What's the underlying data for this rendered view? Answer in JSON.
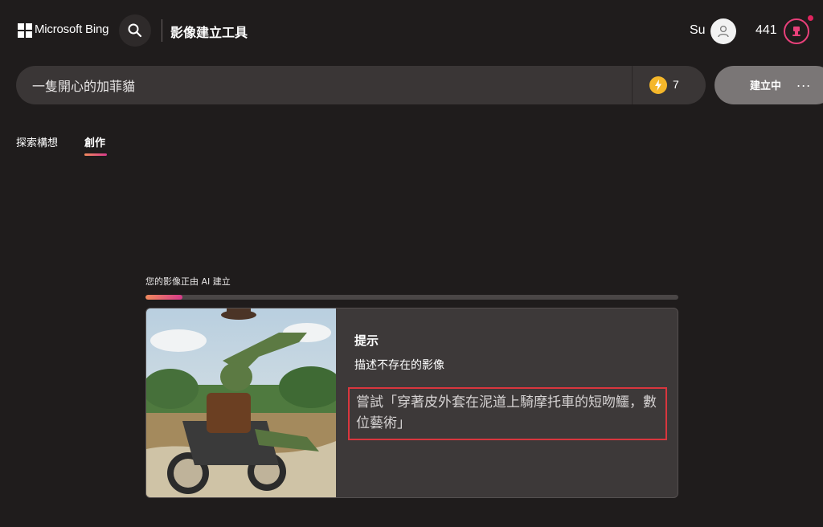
{
  "header": {
    "brand": "Microsoft Bing",
    "tool_title": "影像建立工具",
    "user_name": "Su",
    "points": "441"
  },
  "prompt": {
    "value": "一隻開心的加菲貓",
    "boost_count": "7",
    "create_label": "建立中",
    "more_label": "..."
  },
  "tabs": [
    {
      "label": "探索構想"
    },
    {
      "label": "創作",
      "active": true
    }
  ],
  "progress": {
    "label": "您的影像正由 AI 建立",
    "fraction": 0.07
  },
  "card": {
    "heading": "提示",
    "subheading": "描述不存在的影像",
    "example": "嘗試「穿著皮外套在泥道上騎摩托車的短吻鱷，數位藝術」"
  },
  "colors": {
    "background": "#1f1c1c",
    "accent_start": "#f08a5d",
    "accent_end": "#d63a8a",
    "highlight": "#d9363e",
    "boost": "#f5b72a"
  },
  "icons": [
    "microsoft-logo-icon",
    "search-icon",
    "user-icon",
    "rewards-icon",
    "boost-icon",
    "more-icon"
  ]
}
